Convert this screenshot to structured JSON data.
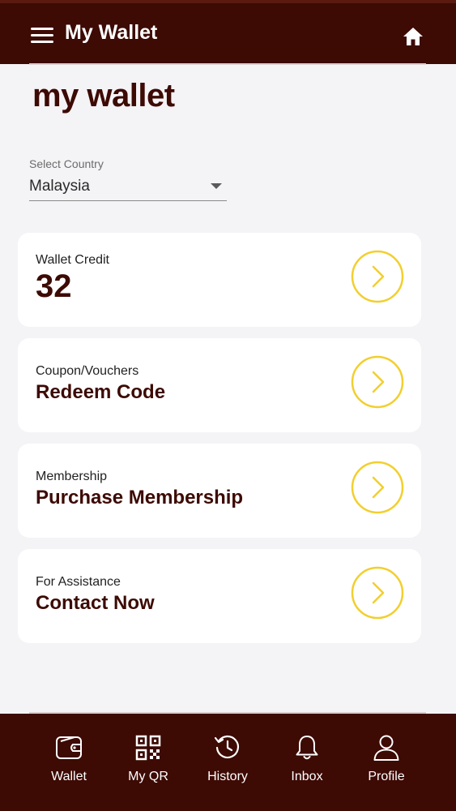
{
  "header": {
    "title": "My Wallet",
    "menu_icon": "hamburger-icon",
    "home_icon": "home-icon"
  },
  "page": {
    "heading": "my wallet"
  },
  "country": {
    "label": "Select Country",
    "value": "Malaysia"
  },
  "cards": [
    {
      "label": "Wallet Credit",
      "value": "32"
    },
    {
      "label": "Coupon/Vouchers",
      "value": "Redeem Code"
    },
    {
      "label": "Membership",
      "value": "Purchase Membership"
    },
    {
      "label": "For Assistance",
      "value": "Contact Now"
    }
  ],
  "nav": [
    {
      "label": "Wallet",
      "icon": "wallet-icon"
    },
    {
      "label": "My QR",
      "icon": "qr-code-icon"
    },
    {
      "label": "History",
      "icon": "history-icon"
    },
    {
      "label": "Inbox",
      "icon": "bell-icon"
    },
    {
      "label": "Profile",
      "icon": "user-icon"
    }
  ],
  "colors": {
    "brand": "#3d0a04",
    "accent": "#f2cf2e",
    "background": "#f4f3f6"
  }
}
